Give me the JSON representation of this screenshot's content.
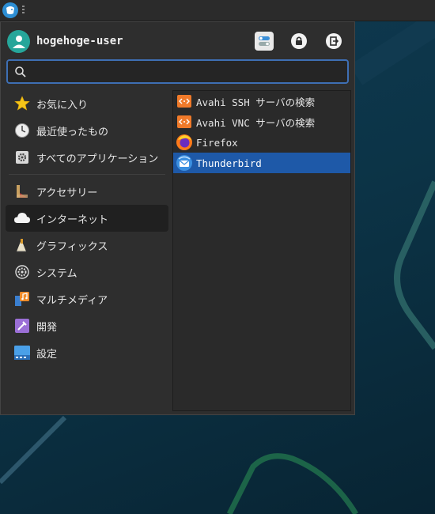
{
  "user": {
    "name": "hogehoge-user"
  },
  "search": {
    "placeholder": ""
  },
  "categories": [
    {
      "label": "お気に入り",
      "icon": "star-icon"
    },
    {
      "label": "最近使ったもの",
      "icon": "clock-icon"
    },
    {
      "label": "すべてのアプリケーション",
      "icon": "apps-gear-icon"
    },
    {
      "label": "アクセサリー",
      "icon": "accessories-icon"
    },
    {
      "label": "インターネット",
      "icon": "cloud-icon"
    },
    {
      "label": "グラフィックス",
      "icon": "graphics-icon"
    },
    {
      "label": "システム",
      "icon": "system-gear-icon"
    },
    {
      "label": "マルチメディア",
      "icon": "multimedia-icon"
    },
    {
      "label": "開発",
      "icon": "development-icon"
    },
    {
      "label": "設定",
      "icon": "settings-icon"
    }
  ],
  "apps": [
    {
      "label": "Avahi SSH サーバの検索",
      "icon": "network-icon"
    },
    {
      "label": "Avahi VNC サーバの検索",
      "icon": "network-icon"
    },
    {
      "label": "Firefox",
      "icon": "firefox-icon"
    },
    {
      "label": "Thunderbird",
      "icon": "thunderbird-icon"
    }
  ],
  "colors": {
    "accent": "#1e59a8",
    "search_border": "#3e6fb4",
    "avatar": "#26a69a"
  }
}
